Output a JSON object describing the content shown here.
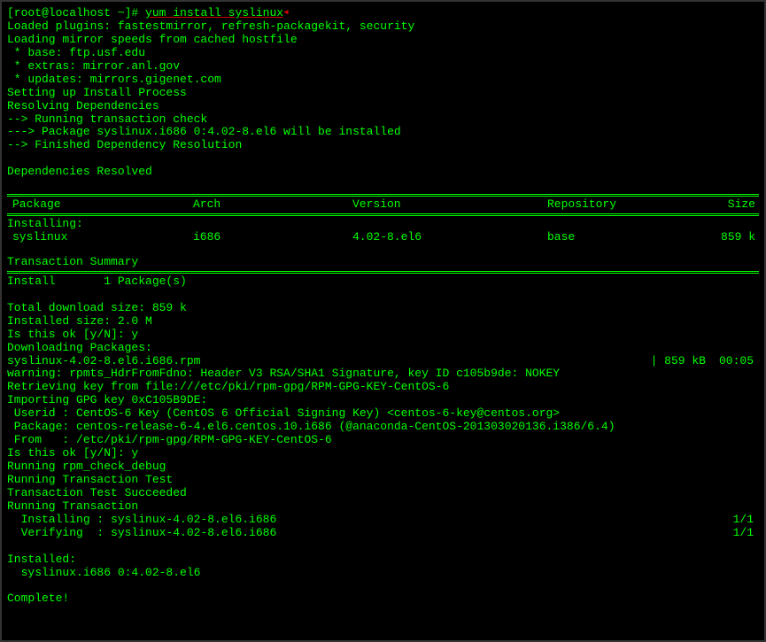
{
  "prompt": "[root@localhost ~]# ",
  "command": "yum install syslinux",
  "lines_pre": [
    "Loaded plugins: fastestmirror, refresh-packagekit, security",
    "Loading mirror speeds from cached hostfile",
    " * base: ftp.usf.edu",
    " * extras: mirror.anl.gov",
    " * updates: mirrors.gigenet.com",
    "Setting up Install Process",
    "Resolving Dependencies",
    "--> Running transaction check",
    "---> Package syslinux.i686 0:4.02-8.el6 will be installed",
    "--> Finished Dependency Resolution",
    "",
    "Dependencies Resolved",
    ""
  ],
  "table": {
    "headers": {
      "package": "Package",
      "arch": "Arch",
      "version": "Version",
      "repo": "Repository",
      "size": "Size"
    },
    "installing_label": "Installing:",
    "rows": [
      {
        "package": "syslinux",
        "arch": "i686",
        "version": "4.02-8.el6",
        "repo": "base",
        "size": "859 k"
      }
    ]
  },
  "trans_summary_label": "Transaction Summary",
  "install_summary": "Install       1 Package(s)",
  "post_summary": [
    "",
    "Total download size: 859 k",
    "Installed size: 2.0 M",
    "Is this ok [y/N]: y",
    "Downloading Packages:"
  ],
  "download": {
    "file": "syslinux-4.02-8.el6.i686.rpm",
    "size": "| 859 kB",
    "time": "00:05"
  },
  "post_download": [
    "warning: rpmts_HdrFromFdno: Header V3 RSA/SHA1 Signature, key ID c105b9de: NOKEY",
    "Retrieving key from file:///etc/pki/rpm-gpg/RPM-GPG-KEY-CentOS-6",
    "Importing GPG key 0xC105B9DE:",
    " Userid : CentOS-6 Key (CentOS 6 Official Signing Key) <centos-6-key@centos.org>",
    " Package: centos-release-6-4.el6.centos.10.i686 (@anaconda-CentOS-201303020136.i386/6.4)",
    " From   : /etc/pki/rpm-gpg/RPM-GPG-KEY-CentOS-6",
    "Is this ok [y/N]: y",
    "Running rpm_check_debug",
    "Running Transaction Test",
    "Transaction Test Succeeded",
    "Running Transaction"
  ],
  "install_rows": [
    {
      "label": "  Installing : syslinux-4.02-8.el6.i686",
      "count": "1/1"
    },
    {
      "label": "  Verifying  : syslinux-4.02-8.el6.i686",
      "count": "1/1"
    }
  ],
  "final": [
    "",
    "Installed:",
    "  syslinux.i686 0:4.02-8.el6",
    "",
    "Complete!"
  ]
}
